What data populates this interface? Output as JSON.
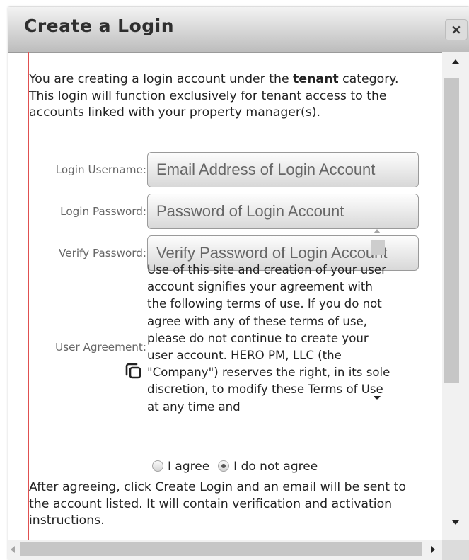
{
  "dialog": {
    "title": "Create a Login",
    "close_label": "×"
  },
  "intro": {
    "before": "You are creating a login account under the ",
    "category": "tenant",
    "after": " category. This login will function exclusively for tenant access to the accounts linked with your property manager(s)."
  },
  "form": {
    "username": {
      "label": "Login Username:",
      "placeholder": "Email Address of Login Account",
      "value": ""
    },
    "password": {
      "label": "Login Password:",
      "placeholder": "Password of Login Account",
      "value": ""
    },
    "verify": {
      "label": "Verify Password:",
      "placeholder": "Verify Password of Login Account",
      "value": ""
    },
    "agreement": {
      "label": "User Agreement:",
      "text": "Use of this site and creation of your user account signifies your agreement with the following terms of use. If you do not agree with any of these terms of use, please do not continue to create your user account. HERO PM, LLC (the \"Company\") reserves the right, in its sole discretion, to modify these Terms of Use at any time and"
    },
    "radios": {
      "agree_label": "I agree",
      "disagree_label": "I do not agree",
      "selected": "I do not agree"
    }
  },
  "footer_text": "After agreeing, click Create Login and an email will be sent to the account listed. It will contain verification and activation instructions.",
  "icons": {
    "close": "close-icon",
    "copy": "copy-icon",
    "scroll_up": "arrow-up-icon",
    "scroll_down": "arrow-down-icon",
    "scroll_left": "arrow-left-icon",
    "scroll_right": "arrow-right-icon"
  },
  "colors": {
    "content_border": "#e05050",
    "title_gradient_top": "#f3f3f3",
    "title_gradient_bottom": "#bcbcbc"
  }
}
